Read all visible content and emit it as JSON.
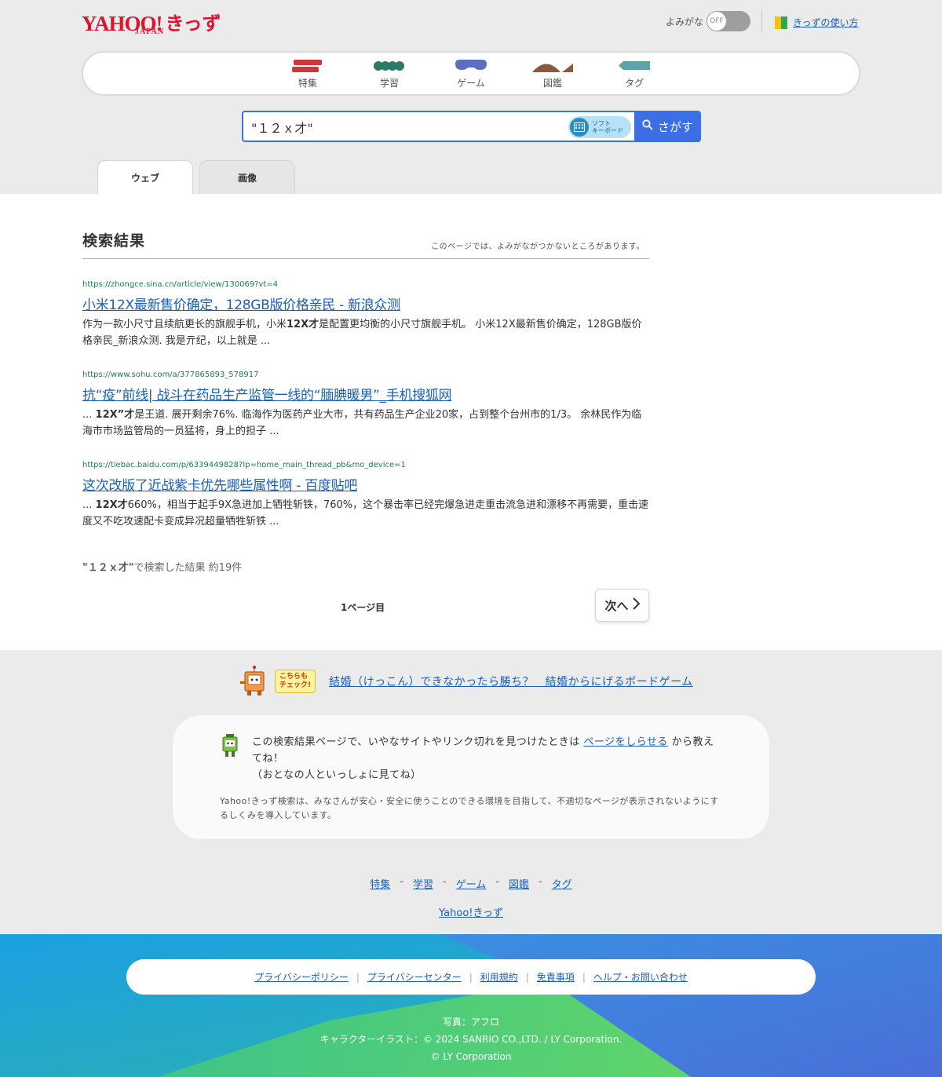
{
  "header": {
    "logo_main": "YAHOO!",
    "logo_sub": "JAPAN",
    "logo_kids": "きっず",
    "yomigana_label": "よみがな",
    "yomigana_state": "OFF",
    "howto_link": "きっずの使い方"
  },
  "nav": [
    {
      "label": "特集",
      "icon": "feature-icon",
      "color": "#c9393d"
    },
    {
      "label": "学習",
      "icon": "study-icon",
      "color": "#2a7b66"
    },
    {
      "label": "ゲーム",
      "icon": "game-icon",
      "color": "#5b6ec0"
    },
    {
      "label": "図鑑",
      "icon": "encyclopedia-icon",
      "color": "#8b5a3c"
    },
    {
      "label": "タグ",
      "icon": "tag-icon",
      "color": "#5ba3a6"
    }
  ],
  "search": {
    "query": "\"１２ｘ才\"",
    "softkb_line1": "ソフト",
    "softkb_line2": "キーボード",
    "button_label": "さがす"
  },
  "tabs": [
    {
      "label": "ウェブ",
      "active": true
    },
    {
      "label": "画像",
      "active": false
    }
  ],
  "results_header": {
    "title": "検索結果",
    "note": "このページでは、よみがながつかないところがあります。"
  },
  "results": [
    {
      "url": "https://zhongce.sina.cn/article/view/130069?vt=4",
      "title": "小米12X最新售价确定，128GB版价格亲民 - 新浪众测",
      "snippet_pre": "作为一款小尺寸且续航更长的旗舰手机，小米",
      "snippet_bold": "12X才",
      "snippet_post": "是配置更均衡的小尺寸旗舰手机。 小米12X最新售价确定，128GB版价格亲民_新浪众测. 我是亓纪，以上就是 ..."
    },
    {
      "url": "https://www.sohu.com/a/377865893_578917",
      "title": "抗“疫”前线| 战斗在药品生产监管一线的“腼腆暖男”_手机搜狐网",
      "snippet_pre": "... ",
      "snippet_bold": "12X”才",
      "snippet_post": "是王道. 展开剩余76%. 临海作为医药产业大市，共有药品生产企业20家，占到整个台州市的1/3。 余林民作为临海市市场监管局的一员猛将，身上的担子 ..."
    },
    {
      "url": "https://tiebac.baidu.com/p/6339449828?lp=home_main_thread_pb&mo_device=1",
      "title": "这次改版了近战紫卡优先哪些属性啊 - 百度贴吧",
      "snippet_pre": "... ",
      "snippet_bold": "12X才",
      "snippet_post": "660%，相当于起手9X急进加上牺牲斩铁，760%，这个暴击率已经完爆急进走重击流急进和漂移不再需要，重击速度又不吃攻速配卡变成异况超量牺牲斩铁 ..."
    }
  ],
  "summary": {
    "query": "\"１２ｘ才\"",
    "text": "で検索した結果 約19件"
  },
  "pagination": {
    "current": "1ページ目",
    "next": "次へ"
  },
  "check": {
    "bubble_line1": "こちらも",
    "bubble_line2": "チェック!",
    "link": "結婚（けっこん）できなかったら勝ち？　結婚からにげるボードゲーム"
  },
  "notice": {
    "text_pre": "この検索結果ページで、いやなサイトやリンク切れを見つけたときは ",
    "link": "ページをしらせる",
    "text_post": " から教えてね！",
    "text_line2": "（おとなの人といっしょに見てね）",
    "small": "Yahoo!きっず検索は、みなさんが安心・安全に使うことのできる環境を目指して、不適切なページが表示されないようにするしくみを導入しています。"
  },
  "footer_nav": [
    "特集",
    "学習",
    "ゲーム",
    "図鑑",
    "タグ"
  ],
  "footer_nav_sep": "-",
  "kids_link": "Yahoo!きっず",
  "footer_links": [
    "プライバシーポリシー",
    "プライバシーセンター",
    "利用規約",
    "免責事項",
    "ヘルプ・お問い合わせ"
  ],
  "footer_sep": "|",
  "credits": {
    "photo": "写真：アフロ",
    "illust": "キャラクターイラスト：© 2024 SANRIO CO.,LTD. / LY Corporation.",
    "copyright": "© LY Corporation"
  },
  "colors": {
    "brand_red": "#e2122c",
    "search_blue": "#3c6fe6",
    "link_blue": "#1a5fb4",
    "url_green": "#1e7a52"
  }
}
